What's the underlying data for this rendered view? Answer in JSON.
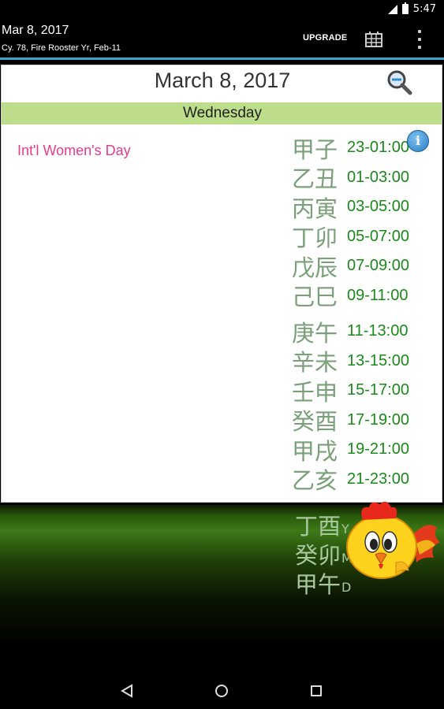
{
  "status_bar": {
    "time": "5:47"
  },
  "action_bar": {
    "date": "Mar 8, 2017",
    "subtitle": "Cy. 78, Fire Rooster Yr, Feb-11",
    "upgrade_label": "UPGRADE",
    "calendar_icon": "calendar-grid-icon",
    "menu_icon": "overflow-menu-icon"
  },
  "day_view": {
    "title": "March 8, 2017",
    "weekday": "Wednesday",
    "holiday": "Int'l Women's Day",
    "info_label": "i",
    "hours": [
      {
        "stem": "甲子",
        "range": "23-01:00"
      },
      {
        "stem": "乙丑",
        "range": "01-03:00"
      },
      {
        "stem": "丙寅",
        "range": "03-05:00"
      },
      {
        "stem": "丁卯",
        "range": "05-07:00"
      },
      {
        "stem": "戊辰",
        "range": "07-09:00"
      },
      {
        "stem": "己巳",
        "range": "09-11:00"
      },
      {
        "stem": "庚午",
        "range": "11-13:00"
      },
      {
        "stem": "辛未",
        "range": "13-15:00"
      },
      {
        "stem": "壬申",
        "range": "15-17:00"
      },
      {
        "stem": "癸酉",
        "range": "17-19:00"
      },
      {
        "stem": "甲戌",
        "range": "19-21:00"
      },
      {
        "stem": "乙亥",
        "range": "21-23:00"
      }
    ]
  },
  "pillars": [
    {
      "text": "丁酉",
      "suffix": "Y"
    },
    {
      "text": "癸卯",
      "suffix": "M"
    },
    {
      "text": "甲午",
      "suffix": "D"
    }
  ],
  "colors": {
    "accent_line": "#3aa6d0",
    "weekday_band": "#bcdd8a",
    "holiday_text": "#e83a8a",
    "hour_range_text": "#1a8a1a"
  }
}
